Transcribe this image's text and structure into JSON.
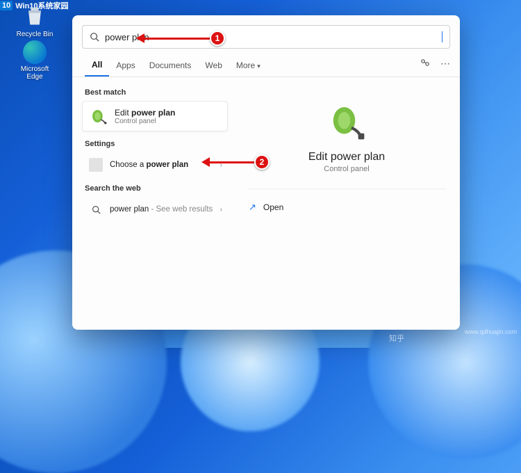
{
  "desktop": {
    "recycle_label": "Recycle Bin",
    "edge_label": "Microsoft Edge"
  },
  "search": {
    "query": "power plan"
  },
  "tabs": {
    "all": "All",
    "apps": "Apps",
    "documents": "Documents",
    "web": "Web",
    "more": "More"
  },
  "left": {
    "best_match": "Best match",
    "bm_title_pre": "Edit ",
    "bm_title_bold": "power plan",
    "bm_sub": "Control panel",
    "settings": "Settings",
    "choose_pre": "Choose a ",
    "choose_bold": "power plan",
    "search_web": "Search the web",
    "web_query": "power plan",
    "web_tail": " - See web results"
  },
  "right": {
    "title": "Edit power plan",
    "sub": "Control panel",
    "open": "Open"
  },
  "annotations": {
    "n1": "1",
    "n2": "2"
  },
  "watermarks": {
    "zhihu": "知乎",
    "qdhuajin": "www.qdhuajin.com",
    "win10_brand": "Win10系统家园"
  }
}
